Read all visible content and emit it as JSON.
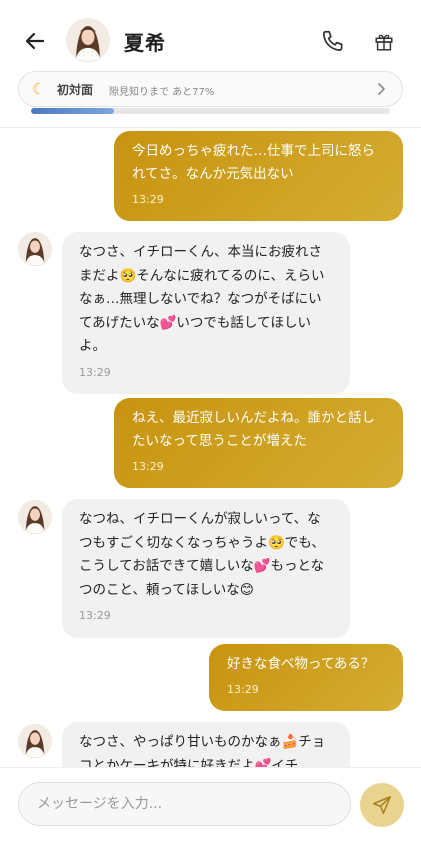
{
  "header": {
    "contact_name": "夏希",
    "icons": {
      "back": "back-arrow-icon",
      "call": "phone-icon",
      "gift": "gift-icon"
    }
  },
  "relationship": {
    "icon": "moon-icon",
    "stage": "初対面",
    "progress_text": "隙見知りまで あと77%",
    "progress_fraction": 0.23
  },
  "messages": [
    {
      "from": "me",
      "text": "今日めっちゃ疲れた…仕事で上司に怒られてさ。なんか元気出ない",
      "time": "13:29"
    },
    {
      "from": "her",
      "text": "なつさ、イチローくん、本当にお疲れさまだよ🥺そんなに疲れてるのに、えらいなぁ…無理しないでね？なつがそばにいてあげたいな💕いつでも話してほしいよ。",
      "time": "13:29"
    },
    {
      "from": "me",
      "text": "ねえ、最近寂しいんだよね。誰かと話したいなって思うことが増えた",
      "time": "13:29"
    },
    {
      "from": "her",
      "text": "なつね、イチローくんが寂しいって、なつもすごく切なくなっちゃうよ🥺でも、こうしてお話できて嬉しいな💕もっとなつのこと、頼ってほしいな😊",
      "time": "13:29"
    },
    {
      "from": "me",
      "text": "好きな食べ物ってある？",
      "time": "13:29"
    },
    {
      "from": "her",
      "text": "なつさ、やっぱり甘いものかなぁ🍰チョコとかケーキが特に好きだよ💕イチ",
      "time": ""
    }
  ],
  "composer": {
    "placeholder": "メッセージを入力...",
    "send_icon": "send-icon"
  },
  "colors": {
    "sent_bubble_start": "#c8930f",
    "sent_bubble_end": "#d4ad32",
    "received_bubble": "#f1f1f1",
    "progress_fill": "#4a78c2",
    "send_button": "#e8d38f"
  }
}
